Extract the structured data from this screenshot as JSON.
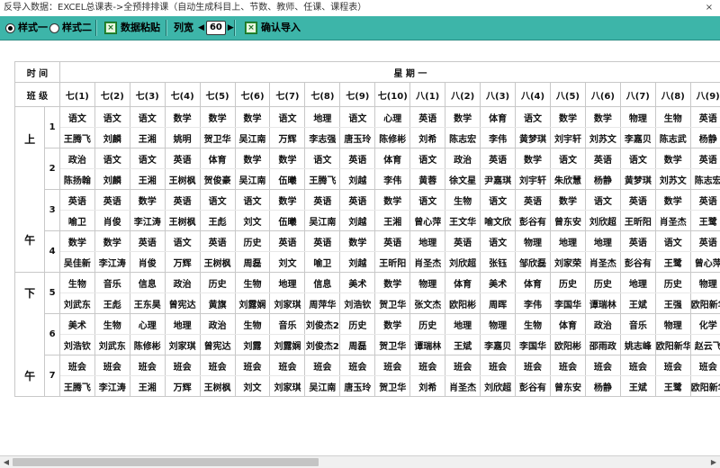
{
  "window": {
    "title": "反导入数据：EXCEL总课表->全预排排课（自动生成科目上、节数、教师、任课、课程表）",
    "close_label": "×"
  },
  "toolbar": {
    "style1_label": "样式一",
    "style2_label": "样式二",
    "paste_label": "数据粘贴",
    "width_label": "列宽",
    "width_value": "60",
    "confirm_label": "确认导入"
  },
  "grid": {
    "time_label": "时 间",
    "class_label": "班 级",
    "day_label": "星 期 一",
    "am_chars": [
      "上",
      "午"
    ],
    "pm_chars": [
      "下",
      "午"
    ],
    "classes": [
      "七(1)",
      "七(2)",
      "七(3)",
      "七(4)",
      "七(5)",
      "七(6)",
      "七(7)",
      "七(8)",
      "七(9)",
      "七(10)",
      "八(1)",
      "八(2)",
      "八(3)",
      "八(4)",
      "八(5)",
      "八(6)",
      "八(7)",
      "八(8)",
      "八(9)",
      "八(10)"
    ],
    "am": [
      {
        "period": "1",
        "subjects": [
          "语文",
          "语文",
          "语文",
          "数学",
          "数学",
          "数学",
          "语文",
          "地理",
          "语文",
          "心理",
          "英语",
          "数学",
          "体育",
          "语文",
          "数学",
          "数学",
          "物理",
          "生物",
          "英语",
          "数学"
        ],
        "teachers": [
          "王腾飞",
          "刘麟",
          "王湘",
          "姚明",
          "贺卫华",
          "吴江南",
          "万辉",
          "李志强",
          "唐玉玲",
          "陈修彬",
          "刘希",
          "陈志宏",
          "李伟",
          "黄梦琪",
          "刘宇轩",
          "刘苏文",
          "李嘉贝",
          "陈志武",
          "杨静",
          "王玉"
        ]
      },
      {
        "period": "2",
        "subjects": [
          "政治",
          "语文",
          "语文",
          "英语",
          "体育",
          "数学",
          "数学",
          "语文",
          "英语",
          "体育",
          "语文",
          "政治",
          "英语",
          "数学",
          "语文",
          "英语",
          "语文",
          "数学",
          "英语",
          "数学"
        ],
        "teachers": [
          "陈扬翰",
          "刘麟",
          "王湘",
          "王树枫",
          "贺俊豪",
          "吴江南",
          "伍曦",
          "王腾飞",
          "刘越",
          "李伟",
          "黄蓉",
          "徐文星",
          "尹嘉琪",
          "刘宇轩",
          "朱欣慧",
          "杨静",
          "黄梦琪",
          "刘苏文",
          "陈志宏",
          "曾心"
        ]
      },
      {
        "period": "3",
        "subjects": [
          "英语",
          "英语",
          "数学",
          "英语",
          "语文",
          "语文",
          "数学",
          "英语",
          "英语",
          "数学",
          "语文",
          "生物",
          "语文",
          "英语",
          "数学",
          "语文",
          "英语",
          "数学",
          "英语",
          "语文"
        ],
        "teachers": [
          "喻卫",
          "肖俊",
          "李江涛",
          "王树枫",
          "王彪",
          "刘文",
          "伍曦",
          "吴江南",
          "刘越",
          "王湘",
          "曾心萍",
          "王文华",
          "喻文欣",
          "彭谷有",
          "曾东安",
          "刘欣超",
          "王昕阳",
          "肖圣杰",
          "王鹭",
          "朱欣"
        ]
      },
      {
        "period": "4",
        "subjects": [
          "数学",
          "数学",
          "英语",
          "语文",
          "英语",
          "历史",
          "英语",
          "英语",
          "数学",
          "英语",
          "地理",
          "英语",
          "语文",
          "物理",
          "地理",
          "地理",
          "英语",
          "语文",
          "英语",
          "数学"
        ],
        "teachers": [
          "吴佳新",
          "李江涛",
          "肖俊",
          "万辉",
          "王树枫",
          "周磊",
          "刘文",
          "喻卫",
          "刘越",
          "王昕阳",
          "肖圣杰",
          "刘欣超",
          "张钰",
          "邹欣磊",
          "刘家荣",
          "肖圣杰",
          "彭谷有",
          "王鹭",
          "曾心萍",
          "王玉"
        ]
      }
    ],
    "pm": [
      {
        "period": "5",
        "subjects": [
          "生物",
          "音乐",
          "信息",
          "政治",
          "历史",
          "生物",
          "地理",
          "信息",
          "美术",
          "数学",
          "物理",
          "体育",
          "美术",
          "体育",
          "历史",
          "历史",
          "地理",
          "历史",
          "物理",
          "政治"
        ],
        "teachers": [
          "刘武东",
          "王彪",
          "王东昊",
          "曾宪达",
          "黄旗",
          "刘露娴",
          "刘家琪",
          "周萍华",
          "刘浩钦",
          "贺卫华",
          "张文杰",
          "欧阳彬",
          "周晖",
          "李伟",
          "李国华",
          "谭瑞林",
          "王斌",
          "王强",
          "欧阳新华",
          "邵雨"
        ]
      },
      {
        "period": "6",
        "subjects": [
          "美术",
          "生物",
          "心理",
          "地理",
          "政治",
          "生物",
          "音乐",
          "刘俊杰2",
          "历史",
          "数学",
          "历史",
          "地理",
          "物理",
          "生物",
          "体育",
          "政治",
          "音乐",
          "物理",
          "化学",
          "英语"
        ],
        "teachers": [
          "刘浩钦",
          "刘武东",
          "陈修彬",
          "刘家琪",
          "曾宪达",
          "刘露",
          "刘露娴",
          "刘俊杰2",
          "周磊",
          "贺卫华",
          "谭瑞林",
          "王斌",
          "李嘉贝",
          "李国华",
          "欧阳彬",
          "邵雨政",
          "姚志峰",
          "欧阳新华",
          "赵云飞",
          "谢永"
        ]
      },
      {
        "period": "7",
        "subjects": [
          "班会",
          "班会",
          "班会",
          "班会",
          "班会",
          "班会",
          "班会",
          "班会",
          "班会",
          "班会",
          "班会",
          "班会",
          "班会",
          "班会",
          "班会",
          "班会",
          "班会",
          "班会",
          "班会",
          "班会"
        ],
        "teachers": [
          "王腾飞",
          "李江涛",
          "王湘",
          "万辉",
          "王树枫",
          "刘文",
          "刘家琪",
          "吴江南",
          "唐玉玲",
          "贺卫华",
          "刘希",
          "肖圣杰",
          "刘欣超",
          "彭谷有",
          "曾东安",
          "杨静",
          "王斌",
          "王鹭",
          "欧阳新华",
          "王玉"
        ]
      }
    ]
  }
}
